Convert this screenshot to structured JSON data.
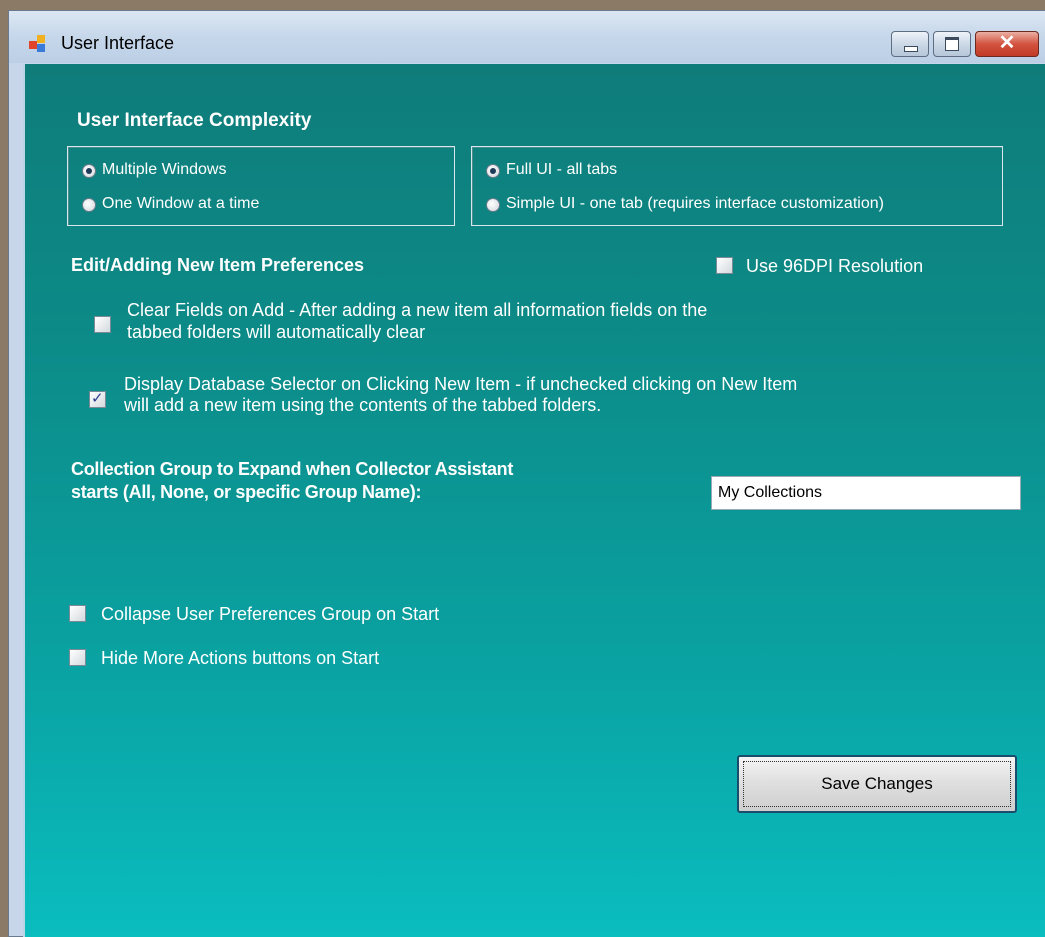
{
  "window": {
    "title": "User Interface"
  },
  "complexity": {
    "heading": "User Interface Complexity",
    "window_mode": {
      "options": [
        "Multiple Windows",
        "One Window at a time"
      ],
      "selected": "Multiple Windows"
    },
    "ui_mode": {
      "options": [
        "Full UI - all tabs",
        "Simple UI - one tab (requires interface customization)"
      ],
      "selected": "Full UI - all tabs"
    }
  },
  "edit_prefs": {
    "heading": "Edit/Adding New Item Preferences",
    "use_96dpi": {
      "label": "Use 96DPI Resolution",
      "checked": false
    },
    "clear_fields": {
      "label_line1": "Clear Fields on Add - After adding a new item all information fields on the",
      "label_line2": "tabbed folders will automatically clear",
      "checked": false
    },
    "display_db_selector": {
      "label_line1": "Display Database Selector on Clicking New Item - if unchecked clicking on New Item",
      "label_line2": "will add a new item using the contents of the tabbed folders.",
      "checked": true
    }
  },
  "collection_group": {
    "label_line1": "Collection Group to Expand when Collector Assistant",
    "label_line2": "starts (All, None, or specific Group Name):",
    "value": "My Collections"
  },
  "start_options": {
    "collapse_prefs": {
      "label": "Collapse User Preferences Group on Start",
      "checked": false
    },
    "hide_more_actions": {
      "label": "Hide More Actions buttons on Start",
      "checked": false
    }
  },
  "actions": {
    "save_label": "Save Changes"
  },
  "colors": {
    "client_top": "#0f7c7a",
    "client_bottom": "#0abdbf",
    "titlebar": "#c6d7ea",
    "close_button": "#c23a25"
  }
}
